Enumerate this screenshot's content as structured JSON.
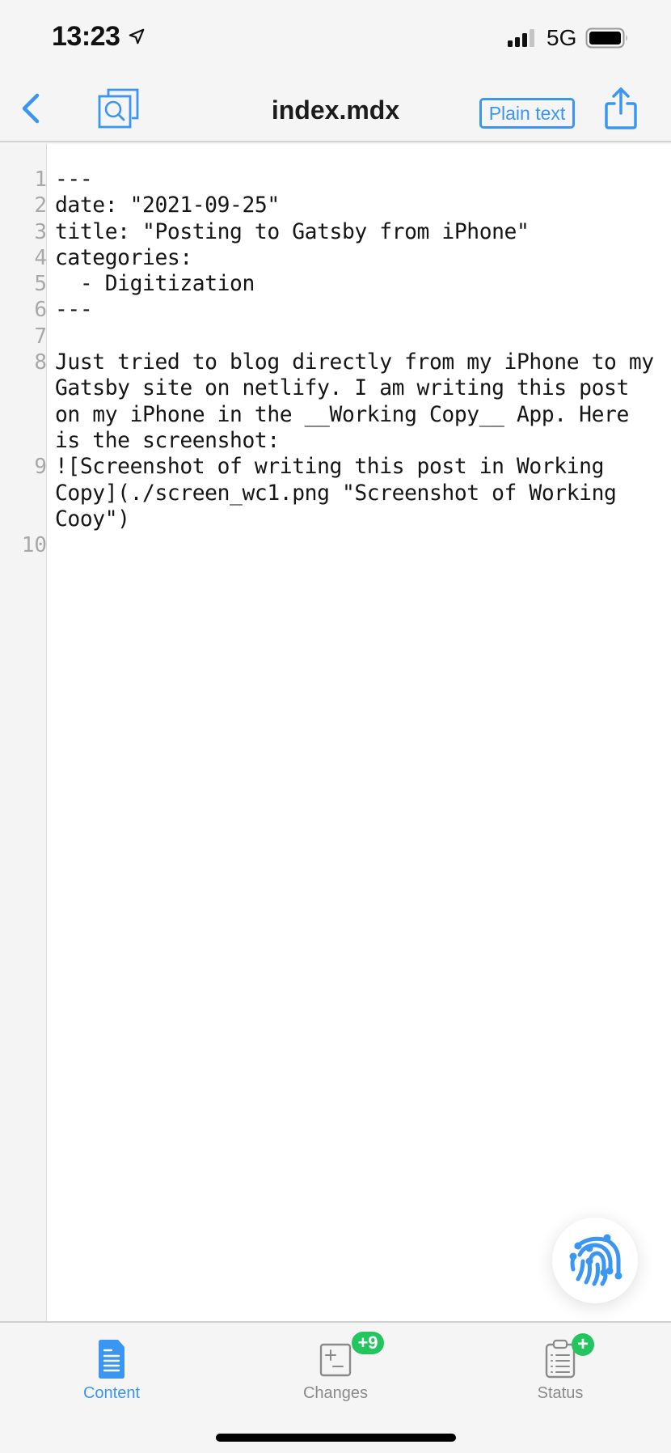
{
  "status_bar": {
    "time": "13:23",
    "network": "5G",
    "icons": [
      "location-arrow-icon",
      "signal-icon",
      "battery-icon"
    ]
  },
  "nav": {
    "title": "index.mdx",
    "mode_button": "Plain text",
    "icons": [
      "chevron-left-icon",
      "search-files-icon",
      "share-icon"
    ]
  },
  "colors": {
    "accent": "#3a96f0",
    "badge_green": "#22c55e",
    "line_number": "#a8a8a8",
    "inactive_tab": "#8a8a8a"
  },
  "editor": {
    "lines": [
      {
        "number": "1",
        "text": "---"
      },
      {
        "number": "2",
        "text": "date: \"2021-09-25\""
      },
      {
        "number": "3",
        "text": "title: \"Posting to Gatsby from iPhone\""
      },
      {
        "number": "4",
        "text": "categories:"
      },
      {
        "number": "5",
        "text": "  - Digitization"
      },
      {
        "number": "6",
        "text": "---"
      },
      {
        "number": "7",
        "text": ""
      },
      {
        "number": "8",
        "text": "Just tried to blog directly from my iPhone to my Gatsby site on netlify. I am writing this post on my iPhone in the __Working Copy__ App. Here is the screenshot:"
      },
      {
        "number": "9",
        "text": "![Screenshot of writing this post in Working Copy](./screen_wc1.png \"Screenshot of Working Cooy\")"
      },
      {
        "number": "10",
        "text": ""
      }
    ]
  },
  "fab": {
    "icon": "fingerprint-icon"
  },
  "tabs": [
    {
      "label": "Content",
      "icon": "document-icon",
      "active": true,
      "badge": ""
    },
    {
      "label": "Changes",
      "icon": "diff-icon",
      "active": false,
      "badge": "+9"
    },
    {
      "label": "Status",
      "icon": "clipboard-list-icon",
      "active": false,
      "badge": "+"
    }
  ]
}
